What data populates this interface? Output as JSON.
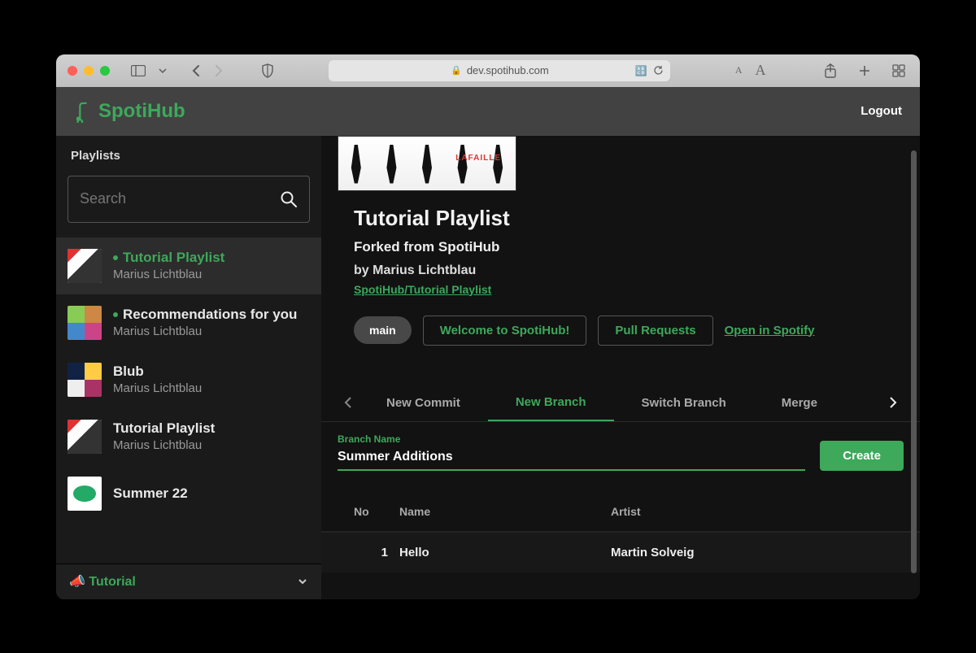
{
  "browser": {
    "url": "dev.spotihub.com"
  },
  "header": {
    "brand": "SpotiHub",
    "logout": "Logout"
  },
  "sidebar": {
    "heading": "Playlists",
    "search_placeholder": "Search",
    "items": [
      {
        "title": "Tutorial Playlist",
        "owner": "Marius Lichtblau",
        "dotted": true,
        "active": true,
        "green": true
      },
      {
        "title": "Recommendations for you",
        "owner": "Marius Lichtblau",
        "dotted": true,
        "active": false,
        "green": false
      },
      {
        "title": "Blub",
        "owner": "Marius Lichtblau",
        "dotted": false,
        "active": false,
        "green": false
      },
      {
        "title": "Tutorial Playlist",
        "owner": "Marius Lichtblau",
        "dotted": false,
        "active": false,
        "green": false
      },
      {
        "title": "Summer 22",
        "owner": "",
        "dotted": false,
        "active": false,
        "green": false
      }
    ],
    "footer": {
      "icon": "📣",
      "label": "Tutorial"
    }
  },
  "main": {
    "cover_label": "LAFAILLE",
    "title": "Tutorial Playlist",
    "forked": "Forked from SpotiHub",
    "by": "by Marius Lichtblau",
    "path": "SpotiHub/Tutorial Playlist",
    "buttons": {
      "branch": "main",
      "welcome": "Welcome to SpotiHub!",
      "pulls": "Pull Requests",
      "open": "Open in Spotify"
    },
    "tabs": {
      "items": [
        "New Commit",
        "New Branch",
        "Switch Branch",
        "Merge"
      ],
      "active": "New Branch"
    },
    "branch_form": {
      "label": "Branch Name",
      "value": "Summer Additions",
      "create": "Create"
    },
    "table": {
      "headers": {
        "no": "No",
        "name": "Name",
        "artist": "Artist"
      },
      "rows": [
        {
          "no": "1",
          "name": "Hello",
          "artist": "Martin Solveig"
        }
      ]
    }
  }
}
